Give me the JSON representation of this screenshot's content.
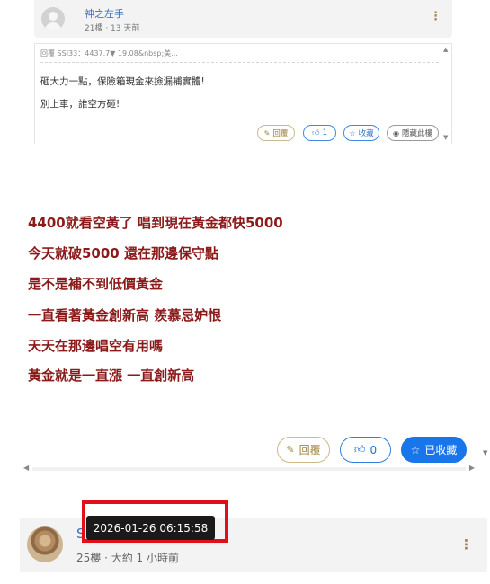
{
  "embedded_post": {
    "author": "神之左手",
    "meta": "21樓 · 13 天前",
    "quote": "回覆 SSI33：4437.7▼ 19.08&nbsp;美...",
    "lines": [
      "砸大力一點，保險箱現金來撿漏補實體!",
      "別上車，誰空方砸!"
    ],
    "buttons": {
      "reply": "回覆",
      "like_count": "1",
      "favorite": "收藏",
      "hide": "隱藏此樓"
    },
    "icons": [
      "pencil-icon",
      "thumbs-up-icon",
      "star-icon",
      "eye-icon",
      "kebab-icon"
    ]
  },
  "message": {
    "lines": [
      "4400就看空黃了 唱到現在黃金都快5000",
      "今天就破5000 還在那邊保守點",
      "是不是補不到低價黃金",
      "一直看著黃金創新高 羨慕忌妒恨",
      "天天在那邊唱空有用嗎",
      "黃金就是一直漲 一直創新高"
    ]
  },
  "actions": {
    "reply": "回覆",
    "like_count": "0",
    "favorited": "已收藏"
  },
  "next_post": {
    "author_initial": "S",
    "meta": "25樓 · 大約 1 小時前"
  },
  "tooltip": {
    "timestamp": "2026-01-26 06:15:58"
  },
  "colors": {
    "message_text": "#8b1a1a",
    "link_blue": "#3b6fb6",
    "primary_blue": "#1976ea",
    "reply_gold": "#a0843f",
    "highlight_red": "#e0101b"
  }
}
